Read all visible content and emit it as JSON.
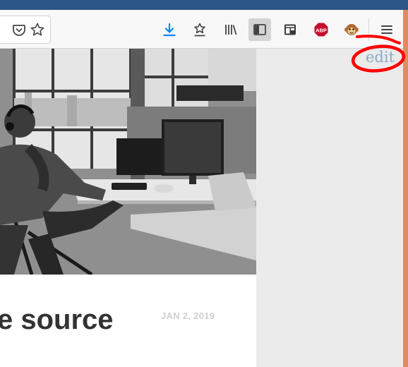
{
  "browser": {
    "toolbar_icons": [
      {
        "name": "pocket-icon"
      },
      {
        "name": "bookmark-star-icon"
      },
      {
        "name": "download-icon"
      },
      {
        "name": "bookmarks-toolbar-icon"
      },
      {
        "name": "library-icon"
      },
      {
        "name": "sidebar-icon",
        "active": true
      },
      {
        "name": "reader-view-icon"
      },
      {
        "name": "adblock-plus-icon",
        "label": "ABP"
      },
      {
        "name": "monkey-extension-icon"
      },
      {
        "name": "menu-icon"
      }
    ],
    "colors": {
      "titlebar": "#2a5586",
      "download_accent": "#0a84ff",
      "abp_red": "#c70d2c",
      "annotation_red": "#ff0000",
      "edit_link": "#8aa9c9"
    }
  },
  "page": {
    "edit_link": "edit",
    "article": {
      "headline": "e source",
      "date": "JAN 2, 2019",
      "image_alt": "man in headphones reclining at a desk with computer monitors"
    }
  }
}
